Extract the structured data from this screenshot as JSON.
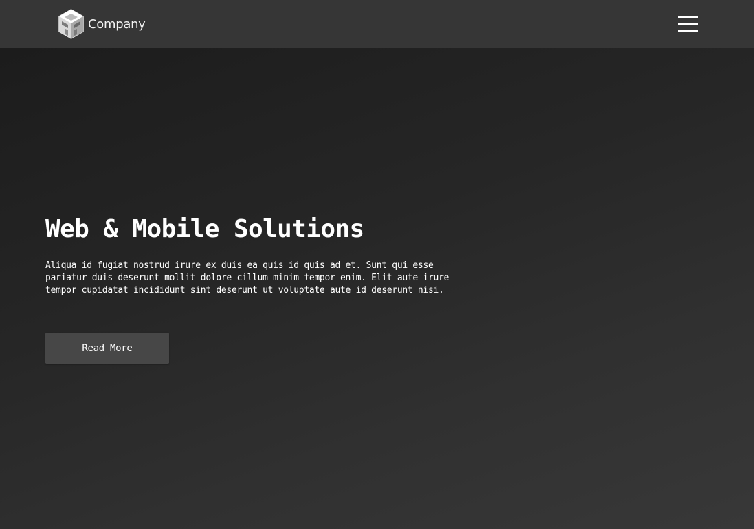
{
  "navbar": {
    "brand_name": "Company",
    "brand_icon": "cube-logo-icon",
    "menu_icon": "hamburger-menu-icon",
    "background": "#363636"
  },
  "hero": {
    "title": "Web & Mobile Solutions",
    "text": "Aliqua id fugiat nostrud irure ex duis ea quis id quis ad et. Sunt qui esse pariatur duis deserunt mollit dolore cillum minim tempor enim. Elit aute irure tempor cupidatat incididunt sint deserunt ut voluptate aute id deserunt nisi.",
    "button_label": "Read More",
    "button_color": "#474747"
  }
}
